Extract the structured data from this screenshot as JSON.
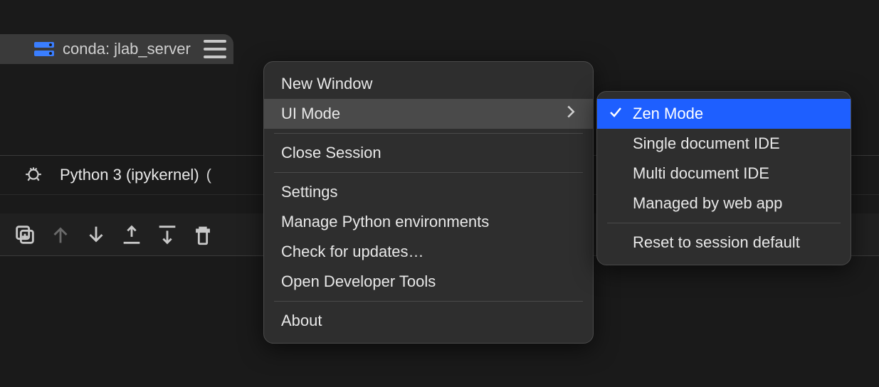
{
  "env": {
    "label": "conda: jlab_server"
  },
  "kernel": {
    "label": "Python 3 (ipykernel)",
    "status_glyph": "("
  },
  "main_menu": {
    "items": [
      {
        "label": "New Window"
      },
      {
        "label": "UI Mode",
        "has_submenu": true,
        "highlighted": true
      },
      {
        "separator": true
      },
      {
        "label": "Close Session"
      },
      {
        "separator": true
      },
      {
        "label": "Settings"
      },
      {
        "label": "Manage Python environments"
      },
      {
        "label": "Check for updates…"
      },
      {
        "label": "Open Developer Tools"
      },
      {
        "separator": true
      },
      {
        "label": "About"
      }
    ]
  },
  "submenu": {
    "items": [
      {
        "label": "Zen Mode",
        "checked": true,
        "selected": true
      },
      {
        "label": "Single document IDE"
      },
      {
        "label": "Multi document IDE"
      },
      {
        "label": "Managed by web app"
      },
      {
        "separator": true
      },
      {
        "label": "Reset to session default"
      }
    ]
  }
}
